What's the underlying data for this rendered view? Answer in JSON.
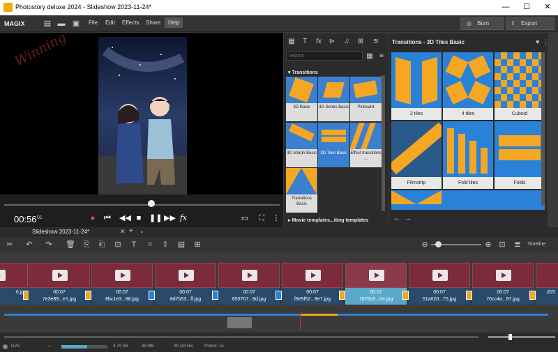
{
  "window": {
    "title": "Photostory deluxe 2024 - Slideshow 2023-11-24*",
    "minimize": "—",
    "maximize": "☐",
    "close": "✕"
  },
  "menubar": {
    "logo": "MAGIX",
    "items": [
      "File",
      "Edit",
      "Effects",
      "Share",
      "Help"
    ],
    "burn": "Burn",
    "export": "Export"
  },
  "preview": {
    "watermark": "Winning"
  },
  "transport": {
    "time": "00:56",
    "frames": "01"
  },
  "media": {
    "search_placeholder": "Search",
    "section": "Transitions",
    "thumbs": [
      "3D Basic",
      "3D Series Basic",
      "Pinboard",
      "3D Morph Basic",
      "3D Tiles Basic",
      "Effect transitions ...",
      "Transitions Basic"
    ],
    "more": "Movie templates...iting templates"
  },
  "transitions": {
    "title": "Transitions - 3D Tiles Basic",
    "tiles": [
      "2 tiles",
      "4 tiles",
      "Cuboid",
      "Filmstrip",
      "Fold tiles",
      "Folds"
    ]
  },
  "story": {
    "tab": "Slideshow 2023-11-24*",
    "add": "+",
    "timeline_label": "Timeline"
  },
  "clips": [
    {
      "dur": "",
      "name": "6.jpg"
    },
    {
      "dur": "00:07",
      "name": "7e3e89...e1.jpg"
    },
    {
      "dur": "00:07",
      "name": "8bc1e3...88.jpg"
    },
    {
      "dur": "00:07",
      "name": "8d7b53...ff.jpg"
    },
    {
      "dur": "00:07",
      "name": "650707...8d.jpg"
    },
    {
      "dur": "00:07",
      "name": "f9e5f52...8e7.jpg"
    },
    {
      "dur": "00:07",
      "name": "7676a3...0e.jpg"
    },
    {
      "dur": "00:07",
      "name": "51a020...75.jpg"
    },
    {
      "dur": "00:07",
      "name": "70cc4a...97.jpg"
    },
    {
      "dur": "",
      "name": "d15"
    }
  ],
  "status": {
    "disc": "DVD",
    "size": "4.70 GB",
    "used": "89 MB",
    "duration": "0h:1m:45s",
    "photos": "Photos: 15"
  },
  "colors": {
    "accent": "#2a82d8",
    "orange": "#f5a623",
    "clip": "#7b2b3a"
  }
}
